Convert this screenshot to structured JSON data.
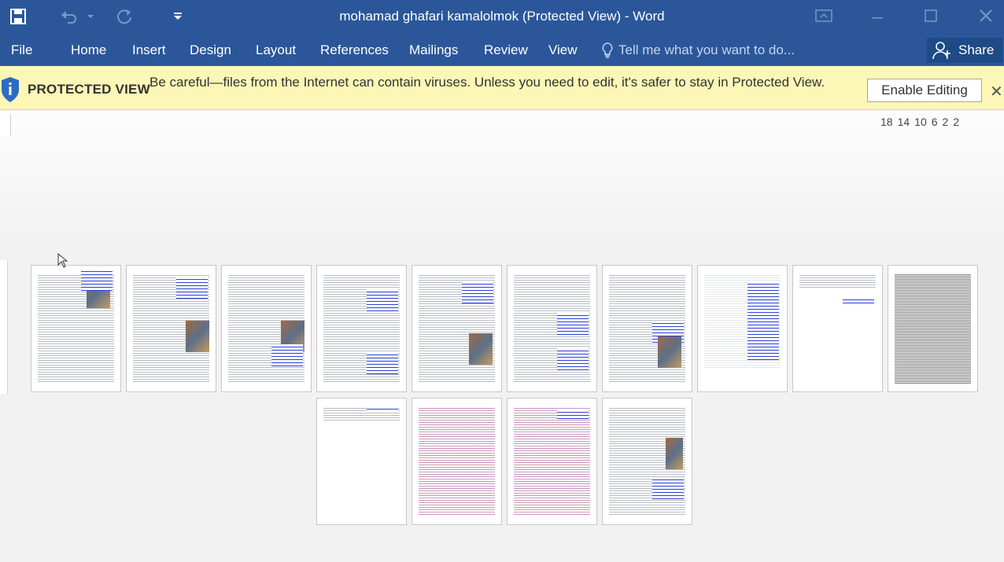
{
  "window": {
    "title": "mohamad ghafari kamalolmok (Protected View) - Word"
  },
  "ribbon": {
    "tabs": [
      "File",
      "Home",
      "Insert",
      "Design",
      "Layout",
      "References",
      "Mailings",
      "Review",
      "View"
    ],
    "tell_me": "Tell me what you want to do...",
    "share": "Share"
  },
  "protected_view": {
    "label": "PROTECTED VIEW",
    "message": "Be careful—files from the Internet can contain viruses. Unless you need to edit, it's safer to stay in Protected View.",
    "enable_button": "Enable Editing"
  },
  "ruler": {
    "ticks": [
      "18",
      "14",
      "10",
      "6",
      "2",
      "2"
    ]
  },
  "colors": {
    "title_bar": "#2b579a",
    "protected_bar": "#fcf7b6",
    "hyperlink": "#2a3fd8"
  }
}
